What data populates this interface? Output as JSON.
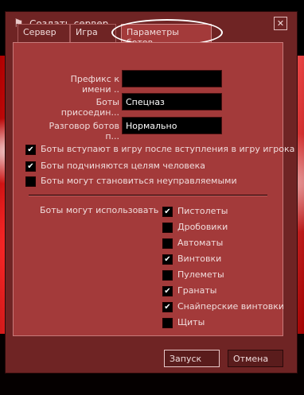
{
  "window": {
    "title": "Создать сервер"
  },
  "tabs": [
    {
      "label": "Сервер",
      "active": false
    },
    {
      "label": "Игра",
      "active": false
    },
    {
      "label": "Параметры ботов",
      "active": true
    }
  ],
  "fields": {
    "prefix": {
      "label": "Префикс к имени ..",
      "value": ""
    },
    "join": {
      "label": "Боты присоедин...",
      "value": "Спецназ"
    },
    "chat": {
      "label": "Разговор ботов п...",
      "value": "Нормально"
    }
  },
  "checks": [
    {
      "label": "Боты вступают в игру после вступления в игру игрока",
      "checked": true
    },
    {
      "label": "Боты подчиняются целям человека",
      "checked": true
    },
    {
      "label": "Боты могут становиться неуправляемыми",
      "checked": false
    }
  ],
  "weapons_label": "Боты могут использовать",
  "weapons": [
    {
      "label": "Пистолеты",
      "checked": true
    },
    {
      "label": "Дробовики",
      "checked": false
    },
    {
      "label": "Автоматы",
      "checked": false
    },
    {
      "label": "Винтовки",
      "checked": true
    },
    {
      "label": "Пулеметы",
      "checked": false
    },
    {
      "label": "Гранаты",
      "checked": true
    },
    {
      "label": "Снайперские винтовки",
      "checked": true
    },
    {
      "label": "Щиты",
      "checked": false
    }
  ],
  "buttons": {
    "start": "Запуск",
    "cancel": "Отмена"
  },
  "check_glyph": "✔"
}
